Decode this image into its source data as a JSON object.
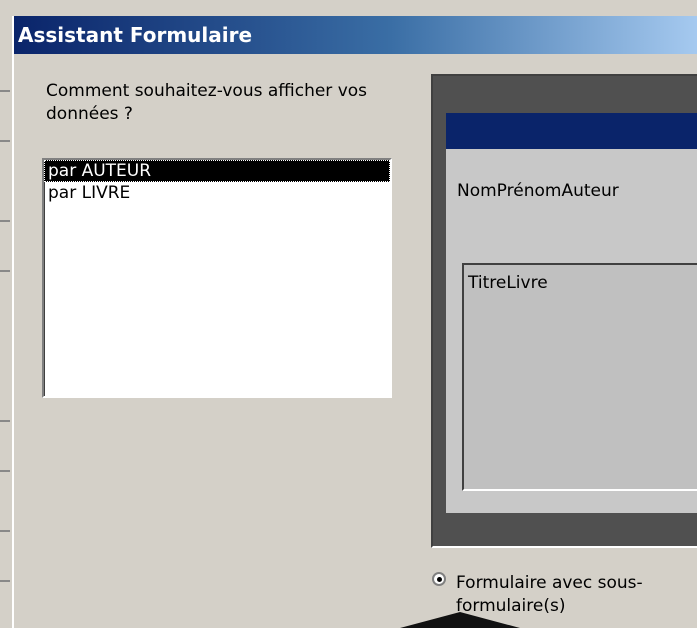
{
  "window": {
    "title": "Assistant Formulaire"
  },
  "question": "Comment souhaitez-vous afficher vos données ?",
  "list": {
    "items": [
      {
        "label": "par AUTEUR",
        "selected": true
      },
      {
        "label": "par LIVRE",
        "selected": false
      }
    ]
  },
  "preview": {
    "main_field": "NomPrénomAuteur",
    "subform_field": "TitreLivre"
  },
  "options": {
    "radio_label": "Formulaire avec sous-formulaire(s)",
    "radio_selected": true
  },
  "colors": {
    "titlebar": "#0a246a",
    "selection": "#000000",
    "background": "#d4d0c8"
  }
}
